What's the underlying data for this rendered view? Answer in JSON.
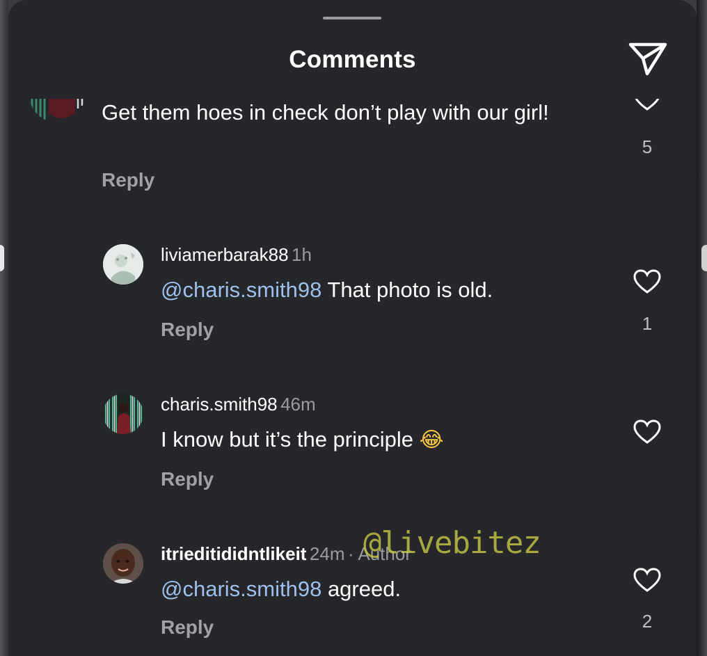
{
  "header": {
    "title": "Comments"
  },
  "comments": [
    {
      "text": "Get them hoes in check don’t play with our girl!",
      "reply_label": "Reply",
      "likes": "5"
    },
    {
      "username": "liviamerbarak88",
      "time": "1h",
      "mention": "@charis.smith98",
      "text": " That photo is old.",
      "reply_label": "Reply",
      "likes": "1"
    },
    {
      "username": "charis.smith98",
      "time": "46m",
      "text": "I know but it’s the principle ",
      "emoji": "😂",
      "reply_label": "Reply"
    },
    {
      "username": "itrieditididntlikeit",
      "time": "24m",
      "author_label": "· Author",
      "mention": "@charis.smith98",
      "text": " agreed.",
      "reply_label": "Reply",
      "likes": "2"
    }
  ],
  "watermark": "@livebitez",
  "colors": {
    "background": "#26272b",
    "mention": "#9dc1ec",
    "secondary_text": "#9a9ba0"
  },
  "icons": {
    "share": "send-icon",
    "like": "heart-outline-icon"
  }
}
